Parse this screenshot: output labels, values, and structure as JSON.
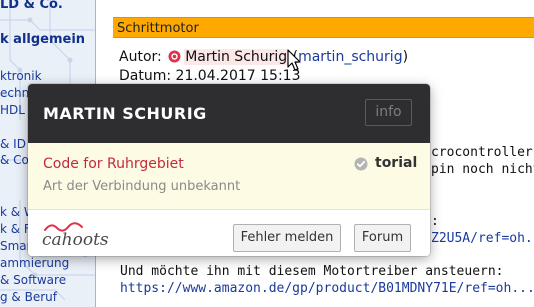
{
  "sidebar": {
    "items": [
      "LD & Co.",
      "k allgemein",
      "ktronik",
      "echnik",
      "HDL &",
      "& ID",
      "& Co",
      "k & W",
      "k & Fe",
      "Smar",
      "ammierung",
      "& Software",
      "g & Beruf"
    ]
  },
  "post": {
    "header": "Schrittmotor",
    "author_label": "Autor:",
    "author_name": "Martin Schurig",
    "author_handle_open": "(",
    "author_handle": "martin_schurig",
    "author_handle_close": ")",
    "date_label": "Datum:",
    "date_value": "21.04.2017 15:13",
    "code_lines": [
      "crocontroller",
      "pin noch nicht",
      ":",
      "Z2U5A/ref=oh...",
      "Und möchte ihn mit diesem Motortreiber ansteuern:",
      "https://www.amazon.de/gp/product/B01MDNY71E/ref=oh..."
    ]
  },
  "popup": {
    "title": "MARTIN SCHURIG",
    "info_label": "info",
    "entry_name": "Code for Ruhrgebiet",
    "entry_subtitle": "Art der Verbindung unbekannt",
    "verified_label": "torial",
    "logo_text": "cahoots",
    "report_button": "Fehler melden",
    "forum_button": "Forum"
  },
  "colors": {
    "header_bar": "#ffa800",
    "popup_head": "#2e2e30",
    "entry_name": "#c22a3c",
    "link": "#1a3a9c",
    "popup_body": "#fdfbe4"
  },
  "icons": {
    "author_icon": "user-dot-icon",
    "verified_icon": "check-circle-icon",
    "cursor": "mouse-pointer-icon"
  }
}
